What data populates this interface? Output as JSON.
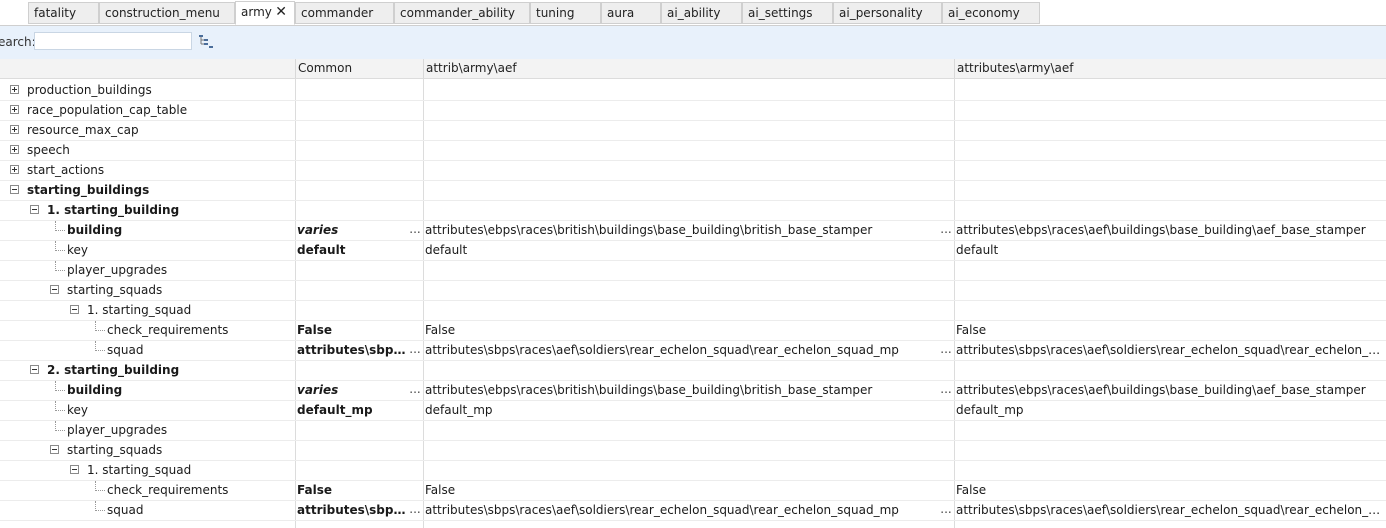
{
  "tabs": [
    {
      "label": "fatality"
    },
    {
      "label": "construction_menu"
    },
    {
      "label": "army",
      "active": true,
      "close": "✕"
    },
    {
      "label": "commander"
    },
    {
      "label": "commander_ability"
    },
    {
      "label": "tuning"
    },
    {
      "label": "aura"
    },
    {
      "label": "ai_ability"
    },
    {
      "label": "ai_settings"
    },
    {
      "label": "ai_personality"
    },
    {
      "label": "ai_economy"
    }
  ],
  "search": {
    "label": "earch:",
    "value": "",
    "placeholder": ""
  },
  "columns": {
    "common": "Common",
    "col1": "attrib\\army\\aef",
    "col2": "attributes\\army\\aef"
  },
  "rows": [
    {
      "name": "production_buildings",
      "common": "",
      "c1": "",
      "c2": ""
    },
    {
      "name": "race_population_cap_table",
      "common": "",
      "c1": "",
      "c2": ""
    },
    {
      "name": "resource_max_cap",
      "common": "",
      "c1": "",
      "c2": ""
    },
    {
      "name": "speech",
      "common": "",
      "c1": "",
      "c2": ""
    },
    {
      "name": "start_actions",
      "common": "",
      "c1": "",
      "c2": ""
    },
    {
      "name": "starting_buildings",
      "common": "",
      "c1": "",
      "c2": ""
    },
    {
      "name": "1. starting_building",
      "common": "",
      "c1": "",
      "c2": ""
    },
    {
      "name": "building",
      "common": "varies",
      "c1": "attributes\\ebps\\races\\british\\buildings\\base_building\\british_base_stamper",
      "c2": "attributes\\ebps\\races\\aef\\buildings\\base_building\\aef_base_stamper",
      "dots": "..."
    },
    {
      "name": "key",
      "common": "default",
      "c1": "default",
      "c2": "default"
    },
    {
      "name": "player_upgrades",
      "common": "",
      "c1": "",
      "c2": ""
    },
    {
      "name": "starting_squads",
      "common": "",
      "c1": "",
      "c2": ""
    },
    {
      "name": "1. starting_squad",
      "common": "",
      "c1": "",
      "c2": ""
    },
    {
      "name": "check_requirements",
      "common": "False",
      "c1": "False",
      "c2": "False"
    },
    {
      "name": "squad",
      "common": "attributes\\sbps\\r...",
      "c1": "attributes\\sbps\\races\\aef\\soldiers\\rear_echelon_squad\\rear_echelon_squad_mp",
      "c2": "attributes\\sbps\\races\\aef\\soldiers\\rear_echelon_squad\\rear_echelon_squad_mp",
      "dots": "..."
    },
    {
      "name": "2. starting_building",
      "common": "",
      "c1": "",
      "c2": ""
    },
    {
      "name": "building",
      "common": "varies",
      "c1": "attributes\\ebps\\races\\british\\buildings\\base_building\\british_base_stamper",
      "c2": "attributes\\ebps\\races\\aef\\buildings\\base_building\\aef_base_stamper",
      "dots": "..."
    },
    {
      "name": "key",
      "common": "default_mp",
      "c1": "default_mp",
      "c2": "default_mp"
    },
    {
      "name": "player_upgrades",
      "common": "",
      "c1": "",
      "c2": ""
    },
    {
      "name": "starting_squads",
      "common": "",
      "c1": "",
      "c2": ""
    },
    {
      "name": "1. starting_squad",
      "common": "",
      "c1": "",
      "c2": ""
    },
    {
      "name": "check_requirements",
      "common": "False",
      "c1": "False",
      "c2": "False"
    },
    {
      "name": "squad",
      "common": "attributes\\sbps\\r...",
      "c1": "attributes\\sbps\\races\\aef\\soldiers\\rear_echelon_squad\\rear_echelon_squad_mp",
      "c2": "attributes\\sbps\\races\\aef\\soldiers\\rear_echelon_squad\\rear_echelon_squad_mp",
      "dots": "..."
    }
  ]
}
